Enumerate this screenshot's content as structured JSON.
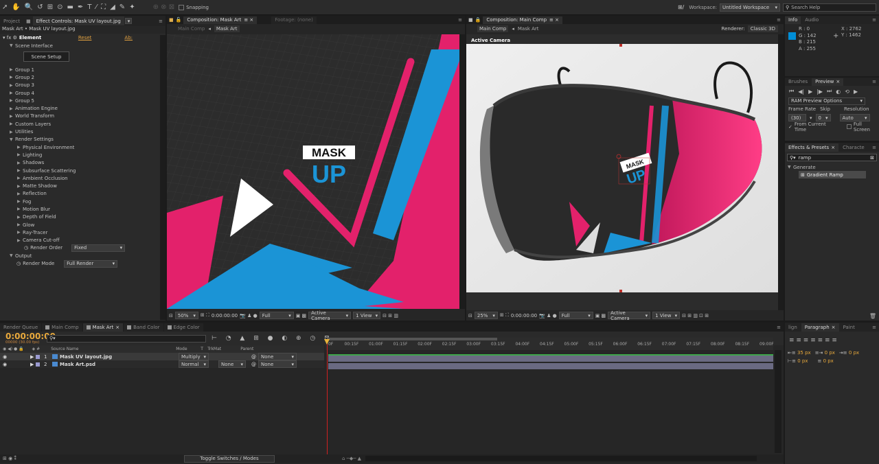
{
  "toolbar": {
    "snapping": "Snapping",
    "workspace_label": "Workspace:",
    "workspace_value": "Untitled Workspace",
    "search": "Search Help"
  },
  "left": {
    "tab_project": "Project",
    "tab_effect": "Effect Controls: Mask UV layout.jpg",
    "breadcrumb": "Mask Art • Mask UV layout.jpg",
    "effect_name": "Element",
    "reset": "Reset",
    "abt": "Ab:",
    "scene_interface": "Scene Interface",
    "scene_setup": "Scene Setup",
    "tree": [
      "Group 1",
      "Group 2",
      "Group 3",
      "Group 4",
      "Group 5",
      "Animation Engine",
      "World Transform",
      "Custom Layers",
      "Utilities",
      "Render Settings"
    ],
    "render": [
      "Physical Environment",
      "Lighting",
      "Shadows",
      "Subsurface Scattering",
      "Ambient Occlusion",
      "Matte Shadow",
      "Reflection",
      "Fog",
      "Motion Blur",
      "Depth of Field",
      "Glow",
      "Ray-Tracer",
      "Camera Cut-off"
    ],
    "render_order_label": "Render Order",
    "render_order_value": "Fixed",
    "output": "Output",
    "render_mode_label": "Render Mode",
    "render_mode_value": "Full Render"
  },
  "comp1": {
    "tab": "Composition: Mask Art",
    "footage": "Footage: (none)",
    "crumb1": "Main Comp",
    "crumb2": "Mask Art",
    "zoom": "50%",
    "time": "0:00:00:00",
    "res": "Full",
    "camera": "Active Camera",
    "views": "1 View"
  },
  "comp2": {
    "tab": "Composition: Main Comp",
    "crumb1": "Main Comp",
    "crumb2": "Mask Art",
    "renderer_label": "Renderer:",
    "renderer": "Classic 3D",
    "active_camera": "Active Camera",
    "zoom": "25%",
    "time": "0:00:00:00",
    "res": "Full",
    "camera": "Active Camera",
    "views": "1 View"
  },
  "art": {
    "logo_top": "MASK",
    "logo_bottom": "UP"
  },
  "info": {
    "tab_info": "Info",
    "tab_audio": "Audio",
    "r": "R : 0",
    "g": "G : 142",
    "b": "B : 215",
    "a": "A : 255",
    "x": "X : 2762",
    "y": "Y : 1462"
  },
  "preview": {
    "tab_brushes": "Brushes",
    "tab_preview": "Preview",
    "ram": "RAM Preview Options",
    "frame_rate": "Frame Rate",
    "skip": "Skip",
    "resolution": "Resolution",
    "fps": "(30)",
    "skip_val": "0",
    "res_val": "Auto",
    "from_current": "From Current Time",
    "full_screen": "Full Screen"
  },
  "effects": {
    "tab": "Effects & Presets",
    "tab2": "Characte",
    "search": "ramp",
    "category": "Generate",
    "item": "Gradient Ramp"
  },
  "para": {
    "tab1": "lign",
    "tab2": "Paragraph",
    "tab3": "Paint",
    "indent1": "35 px",
    "indent2": "0 px",
    "indent3": "0 px",
    "space1": "0 px",
    "space2": "0 px"
  },
  "timeline": {
    "tabs": [
      "Render Queue",
      "Main Comp",
      "Mask Art",
      "Band Color",
      "Edge Color"
    ],
    "timecode": "0:00:00:00",
    "fps": "00000 (30.00 fps)",
    "col_source": "Source Name",
    "col_mode": "Mode",
    "col_t": "T",
    "col_trkmat": "TrkMat",
    "col_parent": "Parent",
    "layers": [
      {
        "num": "1",
        "name": "Mask UV layout.jpg",
        "mode": "Multiply",
        "trkmat": "",
        "parent": "None"
      },
      {
        "num": "2",
        "name": "Mask Art.psd",
        "mode": "Normal",
        "trkmat": "None",
        "parent": "None"
      }
    ],
    "ruler": [
      "0F",
      "00:15F",
      "01:00F",
      "01:15F",
      "02:00F",
      "02:15F",
      "03:00F",
      "03:15F",
      "04:00F",
      "04:15F",
      "05:00F",
      "05:15F",
      "06:00F",
      "06:15F",
      "07:00F",
      "07:15F",
      "08:00F",
      "08:15F",
      "09:00F"
    ],
    "toggle": "Toggle Switches / Modes"
  }
}
